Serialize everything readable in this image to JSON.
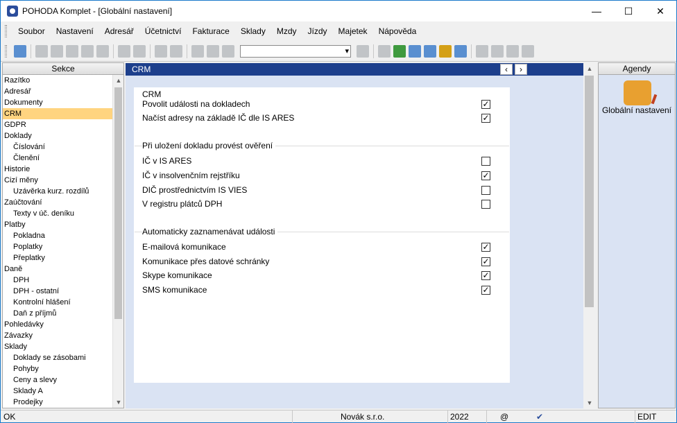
{
  "window": {
    "title": "POHODA Komplet - [Globální nastavení]"
  },
  "menu": [
    {
      "label": "Soubor"
    },
    {
      "label": "Nastavení"
    },
    {
      "label": "Adresář"
    },
    {
      "label": "Účetnictví"
    },
    {
      "label": "Fakturace"
    },
    {
      "label": "Sklady"
    },
    {
      "label": "Mzdy"
    },
    {
      "label": "Jízdy"
    },
    {
      "label": "Majetek"
    },
    {
      "label": "Nápověda"
    }
  ],
  "sekce": {
    "title": "Sekce",
    "items": [
      {
        "label": "Razítko",
        "level": 0
      },
      {
        "label": "Adresář",
        "level": 0
      },
      {
        "label": "Dokumenty",
        "level": 0
      },
      {
        "label": "CRM",
        "level": 0,
        "selected": true
      },
      {
        "label": "GDPR",
        "level": 0
      },
      {
        "label": "Doklady",
        "level": 0
      },
      {
        "label": "Číslování",
        "level": 1
      },
      {
        "label": "Členění",
        "level": 1
      },
      {
        "label": "Historie",
        "level": 0
      },
      {
        "label": "Cizí měny",
        "level": 0
      },
      {
        "label": "Uzávěrka kurz. rozdílů",
        "level": 1
      },
      {
        "label": "Zaúčtování",
        "level": 0
      },
      {
        "label": "Texty v úč. deníku",
        "level": 1
      },
      {
        "label": "Platby",
        "level": 0
      },
      {
        "label": "Pokladna",
        "level": 1
      },
      {
        "label": "Poplatky",
        "level": 1
      },
      {
        "label": "Přeplatky",
        "level": 1
      },
      {
        "label": "Daně",
        "level": 0
      },
      {
        "label": "DPH",
        "level": 1
      },
      {
        "label": "DPH - ostatní",
        "level": 1
      },
      {
        "label": "Kontrolní hlášení",
        "level": 1
      },
      {
        "label": "Daň z příjmů",
        "level": 1
      },
      {
        "label": "Pohledávky",
        "level": 0
      },
      {
        "label": "Závazky",
        "level": 0
      },
      {
        "label": "Sklady",
        "level": 0
      },
      {
        "label": "Doklady se zásobami",
        "level": 1
      },
      {
        "label": "Pohyby",
        "level": 1
      },
      {
        "label": "Ceny a slevy",
        "level": 1
      },
      {
        "label": "Sklady A",
        "level": 1
      },
      {
        "label": "Prodejky",
        "level": 1
      }
    ]
  },
  "crm": {
    "header": "CRM",
    "group1": {
      "title": "CRM",
      "rows": [
        {
          "label": "Povolit události na dokladech",
          "checked": true
        },
        {
          "label": "Načíst adresy na základě IČ dle IS ARES",
          "checked": true
        }
      ]
    },
    "group2": {
      "title": "Při uložení dokladu provést ověření",
      "rows": [
        {
          "label": "IČ v IS ARES",
          "checked": false
        },
        {
          "label": "IČ v insolvenčním rejstříku",
          "checked": true
        },
        {
          "label": "DIČ prostřednictvím IS VIES",
          "checked": false
        },
        {
          "label": "V registru plátců DPH",
          "checked": false
        }
      ]
    },
    "group3": {
      "title": "Automaticky zaznamenávat události",
      "rows": [
        {
          "label": "E-mailová komunikace",
          "checked": true
        },
        {
          "label": "Komunikace přes datové schránky",
          "checked": true
        },
        {
          "label": "Skype komunikace",
          "checked": true
        },
        {
          "label": "SMS komunikace",
          "checked": true
        }
      ]
    }
  },
  "agendy": {
    "title": "Agendy",
    "item": "Globální nastavení"
  },
  "status": {
    "left": "OK",
    "company": "Novák s.r.o.",
    "year": "2022",
    "at": "@",
    "mode": "EDIT"
  }
}
